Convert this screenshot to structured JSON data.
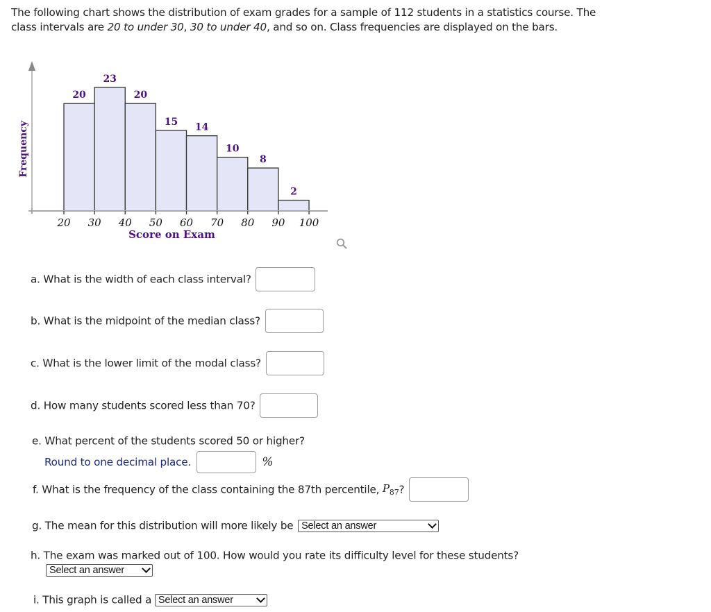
{
  "intro": {
    "part1": "The following chart shows the distribution of exam grades for a sample of 112 students in a statistics course. The class intervals are ",
    "italic1": "20 to under 30",
    "sep": ", ",
    "italic2": "30 to under 40",
    "part2": ", and so on. Class frequencies are displayed on the bars."
  },
  "chart_data": {
    "type": "bar",
    "subtype": "histogram",
    "bin_edges": [
      20,
      30,
      40,
      50,
      60,
      70,
      80,
      90,
      100
    ],
    "categories": [
      "20-30",
      "30-40",
      "40-50",
      "50-60",
      "60-70",
      "70-80",
      "80-90",
      "90-100"
    ],
    "values": [
      20,
      23,
      20,
      15,
      14,
      10,
      8,
      2
    ],
    "data_labels": [
      "20",
      "23",
      "20",
      "15",
      "14",
      "10",
      "8",
      "2"
    ],
    "x_tick_labels": [
      "20",
      "30",
      "40",
      "50",
      "60",
      "70",
      "80",
      "90",
      "100"
    ],
    "title": "",
    "xlabel": "Score on Exam",
    "ylabel": "Frequency",
    "xlim": [
      10,
      110
    ],
    "ylim": [
      0,
      25
    ],
    "grid": false,
    "legend": "none",
    "colors": {
      "bar_fill": "#e4e5f7",
      "bar_stroke": "#333333",
      "label": "#4b1282",
      "axis": "#aaaaaa"
    }
  },
  "search_icon": "magnifier-icon",
  "questions": {
    "a": {
      "label": "a. What is the width of each class interval?",
      "value": ""
    },
    "b": {
      "label": "b. What is the midpoint of the median class?",
      "value": ""
    },
    "c": {
      "label": "c. What is the lower limit of the modal class?",
      "value": ""
    },
    "d": {
      "label": "d. How many students scored less than 70?",
      "value": ""
    },
    "e": {
      "label": "e. What percent of the students scored 50 or higher?",
      "hint": "Round to one decimal place.",
      "unit": "%",
      "value": ""
    },
    "f": {
      "label": "f. What is the frequency of the class containing the 87th percentile, ",
      "var": "P",
      "sub": "87",
      "tail": "?",
      "value": ""
    },
    "g": {
      "label": "g. The mean for this distribution will more likely be",
      "select": "Select an answer"
    },
    "h": {
      "label": "h. The exam was marked out of 100. How would you rate its difficulty level for these students?",
      "select": "Select an answer"
    },
    "i": {
      "label": "i. This graph is called a",
      "select": "Select an answer"
    }
  }
}
